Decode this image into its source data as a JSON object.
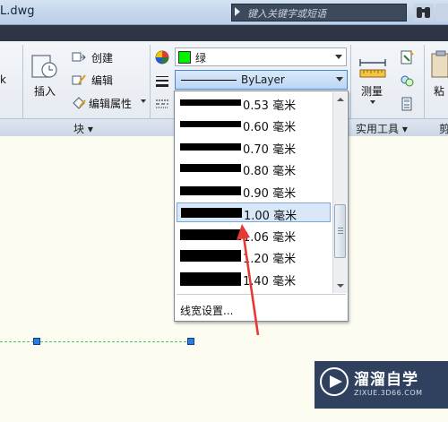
{
  "window": {
    "title": "L.dwg",
    "search_placeholder": "键入关键字或短语"
  },
  "ribbon": {
    "partial_left_label": "k",
    "block_panel": {
      "insert_label": "插入",
      "create_label": "创建",
      "edit_label": "编辑",
      "edit_attributes_label": "编辑属性",
      "panel_title": "块 ▾"
    },
    "properties": {
      "color_value": "绿",
      "color_hex": "#00f000",
      "lineweight_value": "ByLayer"
    },
    "utilities": {
      "measure_label": "测量",
      "panel_title": "实用工具 ▾"
    },
    "partial_right_labels": {
      "paste_label": "粘",
      "clipboard_title": "剪"
    }
  },
  "lineweight_dropdown": {
    "items": [
      {
        "label": "0.53 毫米",
        "selected": false
      },
      {
        "label": "0.60 毫米",
        "selected": false
      },
      {
        "label": "0.70 毫米",
        "selected": false
      },
      {
        "label": "0.80 毫米",
        "selected": false
      },
      {
        "label": "0.90 毫米",
        "selected": false
      },
      {
        "label": "1.00 毫米",
        "selected": true
      },
      {
        "label": "1.06 毫米",
        "selected": false
      },
      {
        "label": "1.20 毫米",
        "selected": false
      },
      {
        "label": "1.40 毫米",
        "selected": false
      }
    ],
    "footer": "线宽设置..."
  },
  "colors": {
    "annotation_arrow": "#e53935",
    "grip": "#2c7be0",
    "dashed_line": "#47c16b",
    "selection_border": "#4a86c9"
  },
  "watermark": {
    "title": "溜溜自学",
    "subtitle": "ZIXUE.3D66.COM"
  }
}
